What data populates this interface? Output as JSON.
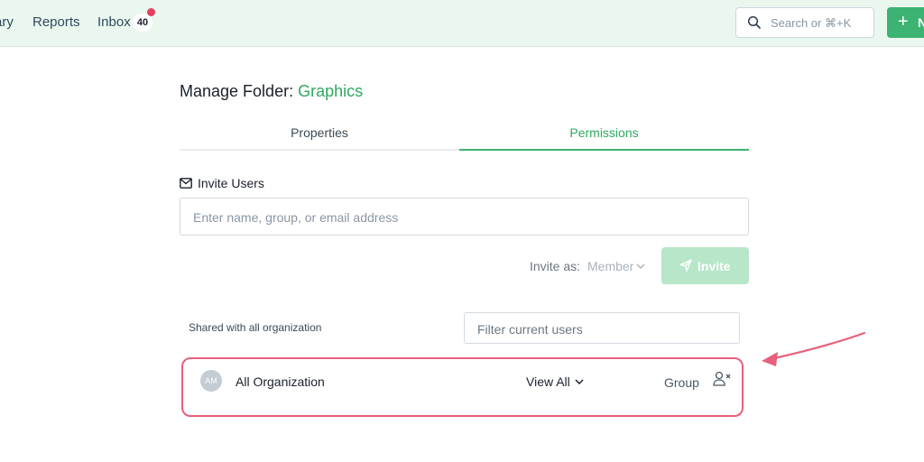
{
  "nav": {
    "library": "ary",
    "reports": "Reports",
    "inbox": "Inbox",
    "inbox_count": "40"
  },
  "search": {
    "placeholder": "Search or ⌘+K"
  },
  "new_button": {
    "label": "N"
  },
  "page": {
    "title_prefix": "Manage Folder:",
    "folder_name": "Graphics"
  },
  "tabs": [
    {
      "label": "Properties",
      "active": false
    },
    {
      "label": "Permissions",
      "active": true
    }
  ],
  "invite": {
    "label": "Invite Users",
    "placeholder": "Enter name, group, or email address",
    "invite_as_label": "Invite as:",
    "role": "Member",
    "button": "Invite"
  },
  "shared": {
    "label": "Shared with all organization",
    "filter_placeholder": "Filter current users",
    "rows": [
      {
        "initials": "AM",
        "name": "All Organization",
        "access": "View All",
        "type": "Group"
      }
    ]
  },
  "icons": {
    "search": "search-icon",
    "plus": "plus-icon",
    "mail": "mail-icon",
    "send": "send-icon",
    "chevron": "chevron-down-icon",
    "remove_user": "user-remove-icon",
    "annotation": "annotation-arrow"
  },
  "colors": {
    "accent": "#3cb371",
    "accent_text": "#2ea860",
    "topbar_bg": "#eaf7ef",
    "badge_dot": "#e53e5e",
    "highlight": "#e8607c",
    "invite_disabled": "#b7e6c8"
  }
}
